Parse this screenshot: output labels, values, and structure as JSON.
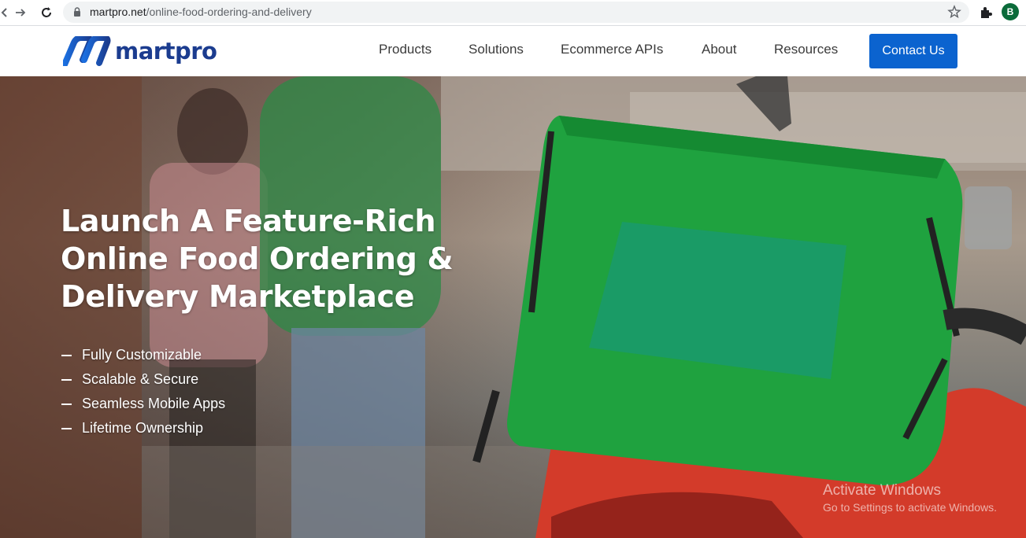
{
  "browser": {
    "url_host": "martpro.net",
    "url_path": "/online-food-ordering-and-delivery",
    "profile_initial": "B"
  },
  "site": {
    "logo_text": "martpro",
    "nav": [
      {
        "label": "Products"
      },
      {
        "label": "Solutions"
      },
      {
        "label": "Ecommerce APIs"
      },
      {
        "label": "About"
      },
      {
        "label": "Resources"
      }
    ],
    "cta_label": "Contact Us"
  },
  "hero": {
    "headline_line1": "Launch A Feature-Rich",
    "headline_line2": "Online Food Ordering &",
    "headline_line3": "Delivery Marketplace",
    "bullets": [
      "Fully Customizable",
      "Scalable & Secure",
      "Seamless Mobile Apps",
      "Lifetime Ownership"
    ]
  },
  "watermark": {
    "line1": "Activate Windows",
    "line2": "Go to Settings to activate Windows."
  },
  "colors": {
    "brand_blue": "#1b3c8f",
    "cta_blue": "#0b63cf",
    "bag_green": "#1fa23f"
  }
}
